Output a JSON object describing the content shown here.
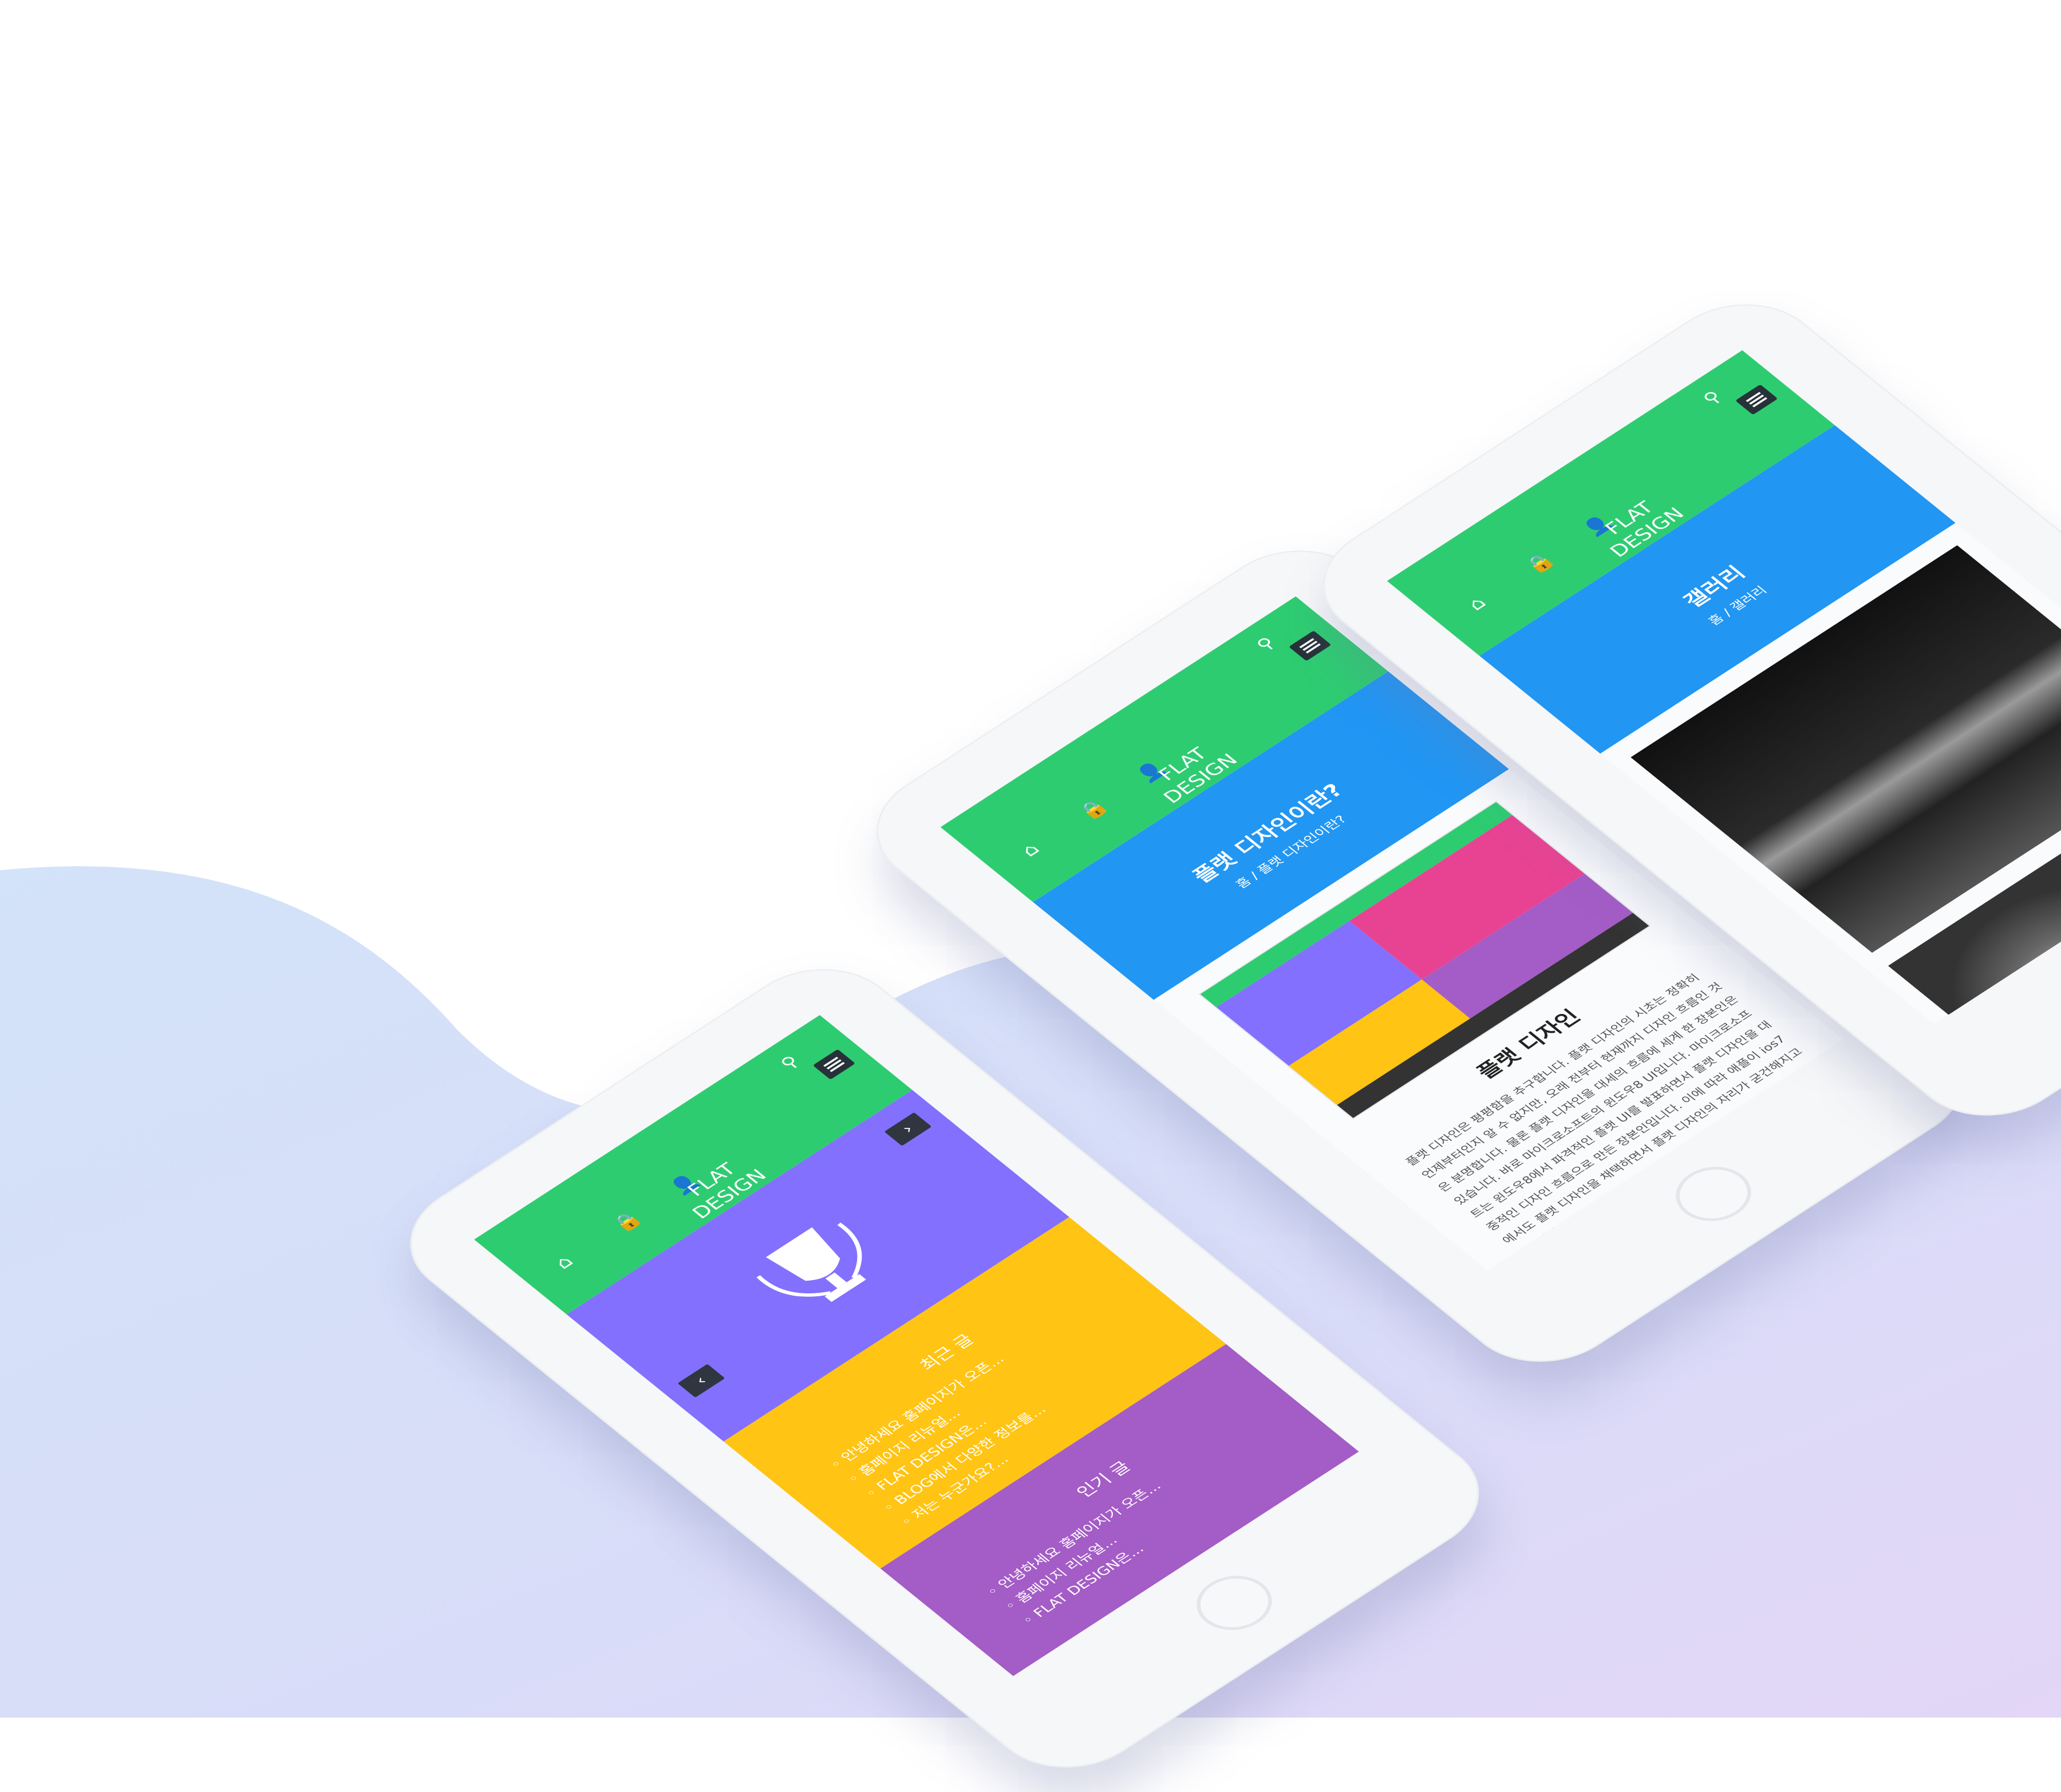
{
  "colors": {
    "nav": "#2ecc71",
    "title_bar": "#2196f3",
    "slide": "#8370fe",
    "recent": "#ffc414",
    "popular": "#a45cc6",
    "menu_button": "#263238"
  },
  "brand": "FLAT\nDESIGN",
  "icons": {
    "home": "⌂",
    "lock": "🔒",
    "user": "👤",
    "search": "⚲",
    "menu": "hamburger-icon",
    "trophy": "trophy-icon",
    "prev": "‹",
    "next": "›"
  },
  "phone_home": {
    "recent_title": "최근 글",
    "recent_items": [
      "안녕하세요 홈페이지가 오픈...",
      "홈페이지 리뉴얼...",
      "FLAT DESIGN은...",
      "BLOG에서 다양한 정보를...",
      "저는 누군가요?..."
    ],
    "popular_title": "인기 글",
    "popular_items": [
      "안녕하세요 홈페이지가 오픈...",
      "홈페이지 리뉴얼...",
      "FLAT DESIGN은..."
    ]
  },
  "phone_article": {
    "title": "플랫 디자인이란?",
    "breadcrumb": "홈 / 플랫 디자인이란?",
    "heading": "플랫 디자인",
    "body": "플랫 디자인은 평평함을 추구합니다. 플랫 디자인의 시초는 정확히 언제부터인지 알 수 없지만, 오래 전부터 현재까지 디자인 흐름인 것은 분명합니다. 물론 플랫 디자인을 대세의 흐름에 세계 한 장본인은 있습니다. 바로 마이크로소프트의 윈도우8 UI입니다. 마이크로소프트는 윈도우8에서 파격적인 플랫 UI를 발표하면서 플랫 디자인을 대중적인 디자인 흐름으로 만든 장본인입니다. 이에 따라 애플이 ios7에서도 플랫 디자인을 채택하면서 플랫 디자인의 자리가 굳건해지고 있습니다."
  },
  "phone_gallery": {
    "title": "갤러리",
    "breadcrumb": "홈 / 갤러리"
  }
}
